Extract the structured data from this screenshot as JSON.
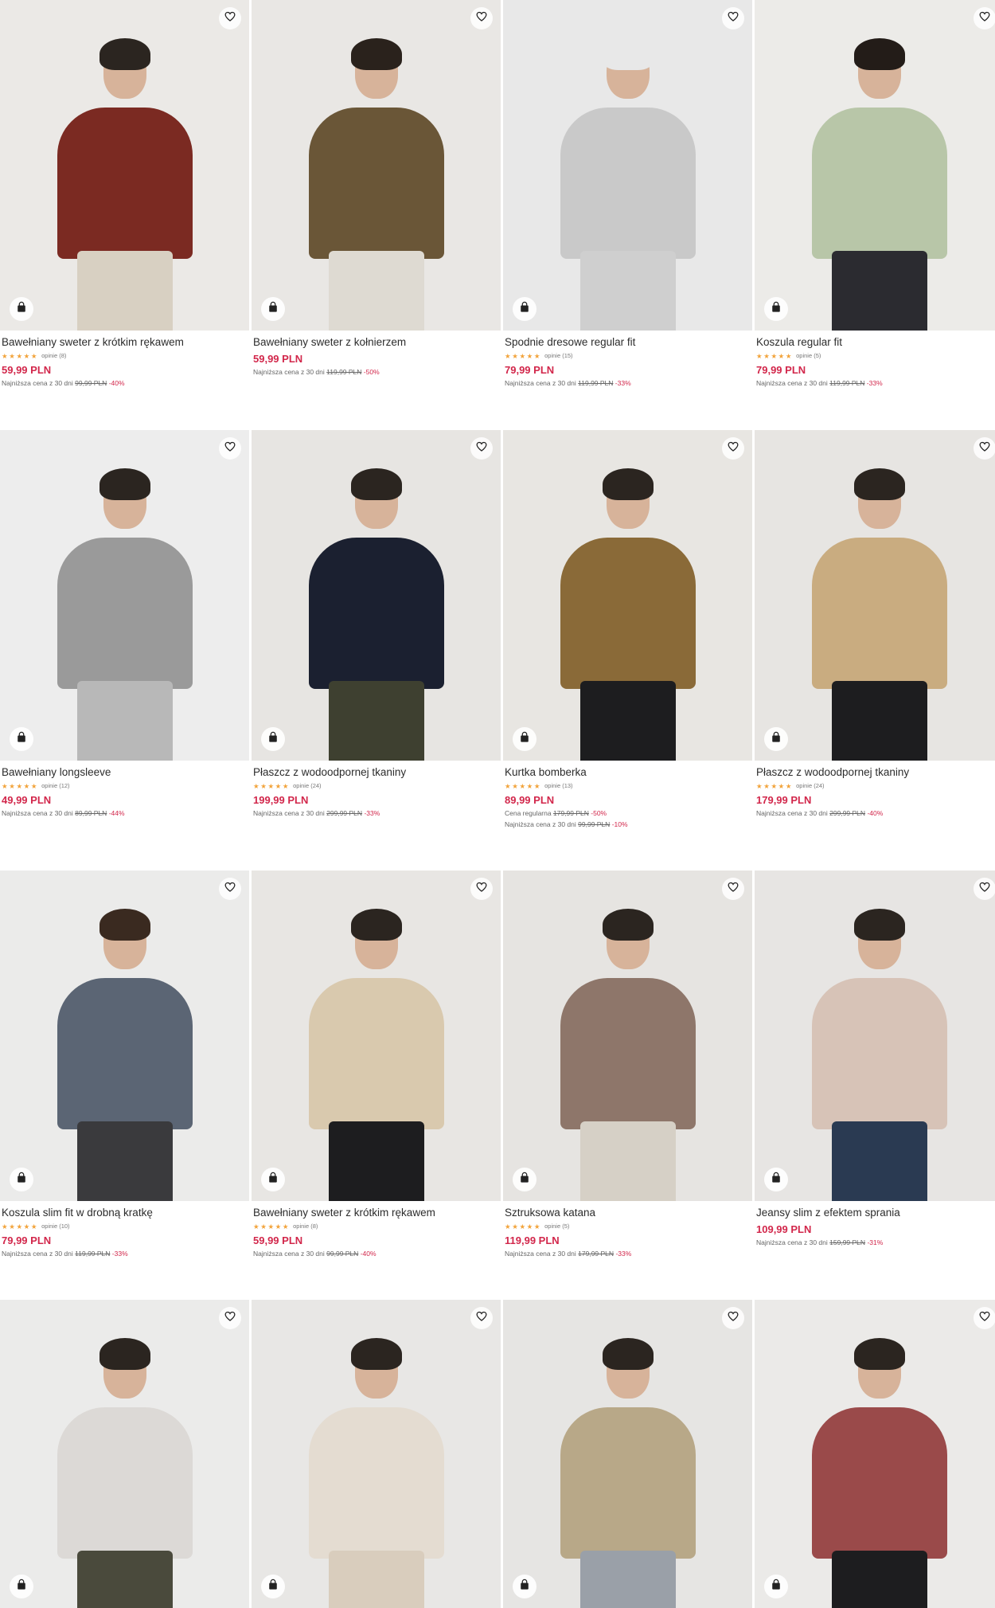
{
  "products": [
    {
      "name": "Bawełniany sweter z krótkim rękawem",
      "stars": "★★★★★",
      "reviews": "opinie (8)",
      "price": "59,99 PLN",
      "regular_label": "",
      "regular_price": "",
      "regular_pct": "",
      "lowest_label": "Najniższa cena z 30 dni",
      "lowest_price": "99,99 PLN",
      "lowest_pct": "-40%",
      "bg": "#ebe9e6",
      "top": "#7b2a22",
      "bottom": "#d8d0c2",
      "hair": "#2b2520"
    },
    {
      "name": "Bawełniany sweter z kołnierzem",
      "stars": "",
      "reviews": "",
      "price": "59,99 PLN",
      "regular_label": "",
      "regular_price": "",
      "regular_pct": "",
      "lowest_label": "Najniższa cena z 30 dni",
      "lowest_price": "119,99 PLN",
      "lowest_pct": "-50%",
      "bg": "#e9e7e4",
      "top": "#6a5637",
      "bottom": "#dedad2",
      "hair": "#2a221c"
    },
    {
      "name": "Spodnie dresowe regular fit",
      "stars": "★★★★★",
      "reviews": "opinie (15)",
      "price": "79,99 PLN",
      "regular_label": "",
      "regular_price": "",
      "regular_pct": "",
      "lowest_label": "Najniższa cena z 30 dni",
      "lowest_price": "119,99 PLN",
      "lowest_pct": "-33%",
      "bg": "#e8e8e8",
      "top": "#c9c9c9",
      "bottom": "#cfcfcf",
      "hair": "#e8e8e8"
    },
    {
      "name": "Koszula regular fit",
      "stars": "★★★★★",
      "reviews": "opinie (5)",
      "price": "79,99 PLN",
      "regular_label": "",
      "regular_price": "",
      "regular_pct": "",
      "lowest_label": "Najniższa cena z 30 dni",
      "lowest_price": "119,99 PLN",
      "lowest_pct": "-33%",
      "bg": "#ecebe8",
      "top": "#b8c6a8",
      "bottom": "#2b2b30",
      "hair": "#231c18"
    },
    {
      "name": "Bawełniany longsleeve",
      "stars": "★★★★★",
      "reviews": "opinie (12)",
      "price": "49,99 PLN",
      "regular_label": "",
      "regular_price": "",
      "regular_pct": "",
      "lowest_label": "Najniższa cena z 30 dni",
      "lowest_price": "89,99 PLN",
      "lowest_pct": "-44%",
      "bg": "#ededed",
      "top": "#9a9a9a",
      "bottom": "#b8b8b8",
      "hair": "#2b2520"
    },
    {
      "name": "Płaszcz z wodoodpornej tkaniny",
      "stars": "★★★★★",
      "reviews": "opinie (24)",
      "price": "199,99 PLN",
      "regular_label": "",
      "regular_price": "",
      "regular_pct": "",
      "lowest_label": "Najniższa cena z 30 dni",
      "lowest_price": "299,99 PLN",
      "lowest_pct": "-33%",
      "bg": "#e7e5e2",
      "top": "#1b2030",
      "bottom": "#3e4030",
      "hair": "#2b2520"
    },
    {
      "name": "Kurtka bomberka",
      "stars": "★★★★★",
      "reviews": "opinie (13)",
      "price": "89,99 PLN",
      "regular_label": "Cena regularna",
      "regular_price": "179,99 PLN",
      "regular_pct": "-50%",
      "lowest_label": "Najniższa cena z 30 dni",
      "lowest_price": "99,99 PLN",
      "lowest_pct": "-10%",
      "bg": "#e8e6e2",
      "top": "#8a6a38",
      "bottom": "#1d1d1f",
      "hair": "#2b2520"
    },
    {
      "name": "Płaszcz z wodoodpornej tkaniny",
      "stars": "★★★★★",
      "reviews": "opinie (24)",
      "price": "179,99 PLN",
      "regular_label": "",
      "regular_price": "",
      "regular_pct": "",
      "lowest_label": "Najniższa cena z 30 dni",
      "lowest_price": "299,99 PLN",
      "lowest_pct": "-40%",
      "bg": "#e7e5e2",
      "top": "#c9ac80",
      "bottom": "#1d1d1f",
      "hair": "#2b2520"
    },
    {
      "name": "Koszula slim fit w drobną kratkę",
      "stars": "★★★★★",
      "reviews": "opinie (10)",
      "price": "79,99 PLN",
      "regular_label": "",
      "regular_price": "",
      "regular_pct": "",
      "lowest_label": "Najniższa cena z 30 dni",
      "lowest_price": "119,99 PLN",
      "lowest_pct": "-33%",
      "bg": "#ebebea",
      "top": "#5b6574",
      "bottom": "#3a3a3d",
      "hair": "#3a2a20"
    },
    {
      "name": "Bawełniany sweter z krótkim rękawem",
      "stars": "★★★★★",
      "reviews": "opinie (8)",
      "price": "59,99 PLN",
      "regular_label": "",
      "regular_price": "",
      "regular_pct": "",
      "lowest_label": "Najniższa cena z 30 dni",
      "lowest_price": "99,99 PLN",
      "lowest_pct": "-40%",
      "bg": "#e8e6e3",
      "top": "#d9c9ae",
      "bottom": "#1d1d1f",
      "hair": "#2b2520"
    },
    {
      "name": "Sztruksowa katana",
      "stars": "★★★★★",
      "reviews": "opinie (5)",
      "price": "119,99 PLN",
      "regular_label": "",
      "regular_price": "",
      "regular_pct": "",
      "lowest_label": "Najniższa cena z 30 dni",
      "lowest_price": "179,99 PLN",
      "lowest_pct": "-33%",
      "bg": "#e6e4e1",
      "top": "#8e766a",
      "bottom": "#d6d0c6",
      "hair": "#2b2520"
    },
    {
      "name": "Jeansy slim z efektem sprania",
      "stars": "",
      "reviews": "",
      "price": "109,99 PLN",
      "regular_label": "",
      "regular_price": "",
      "regular_pct": "",
      "lowest_label": "Najniższa cena z 30 dni",
      "lowest_price": "159,99 PLN",
      "lowest_pct": "-31%",
      "bg": "#e7e5e3",
      "top": "#d7c3b7",
      "bottom": "#2a3a52",
      "hair": "#2b2520"
    },
    {
      "name": "",
      "stars": "",
      "reviews": "",
      "price": "",
      "regular_label": "",
      "regular_price": "",
      "regular_pct": "",
      "lowest_label": "",
      "lowest_price": "",
      "lowest_pct": "",
      "bg": "#ebebea",
      "top": "#dcd9d6",
      "bottom": "#4a4a3c",
      "hair": "#2b2520"
    },
    {
      "name": "",
      "stars": "",
      "reviews": "",
      "price": "",
      "regular_label": "",
      "regular_price": "",
      "regular_pct": "",
      "lowest_label": "",
      "lowest_price": "",
      "lowest_pct": "",
      "bg": "#e8e7e5",
      "top": "#e4dcd1",
      "bottom": "#d9cdbd",
      "hair": "#2b2520"
    },
    {
      "name": "",
      "stars": "",
      "reviews": "",
      "price": "",
      "regular_label": "",
      "regular_price": "",
      "regular_pct": "",
      "lowest_label": "",
      "lowest_price": "",
      "lowest_pct": "",
      "bg": "#e6e5e3",
      "top": "#b8a888",
      "bottom": "#9aa0a8",
      "hair": "#2b2520"
    },
    {
      "name": "",
      "stars": "",
      "reviews": "",
      "price": "",
      "regular_label": "",
      "regular_price": "",
      "regular_pct": "",
      "lowest_label": "",
      "lowest_price": "",
      "lowest_pct": "",
      "bg": "#ebeae8",
      "top": "#9a4a4a",
      "bottom": "#1d1d1f",
      "hair": "#2b2520"
    }
  ],
  "icons": {
    "favorite": "heart-icon",
    "cart": "shopping-bag-icon"
  },
  "colors": {
    "price": "#d2274b",
    "stars": "#f2a33a"
  }
}
